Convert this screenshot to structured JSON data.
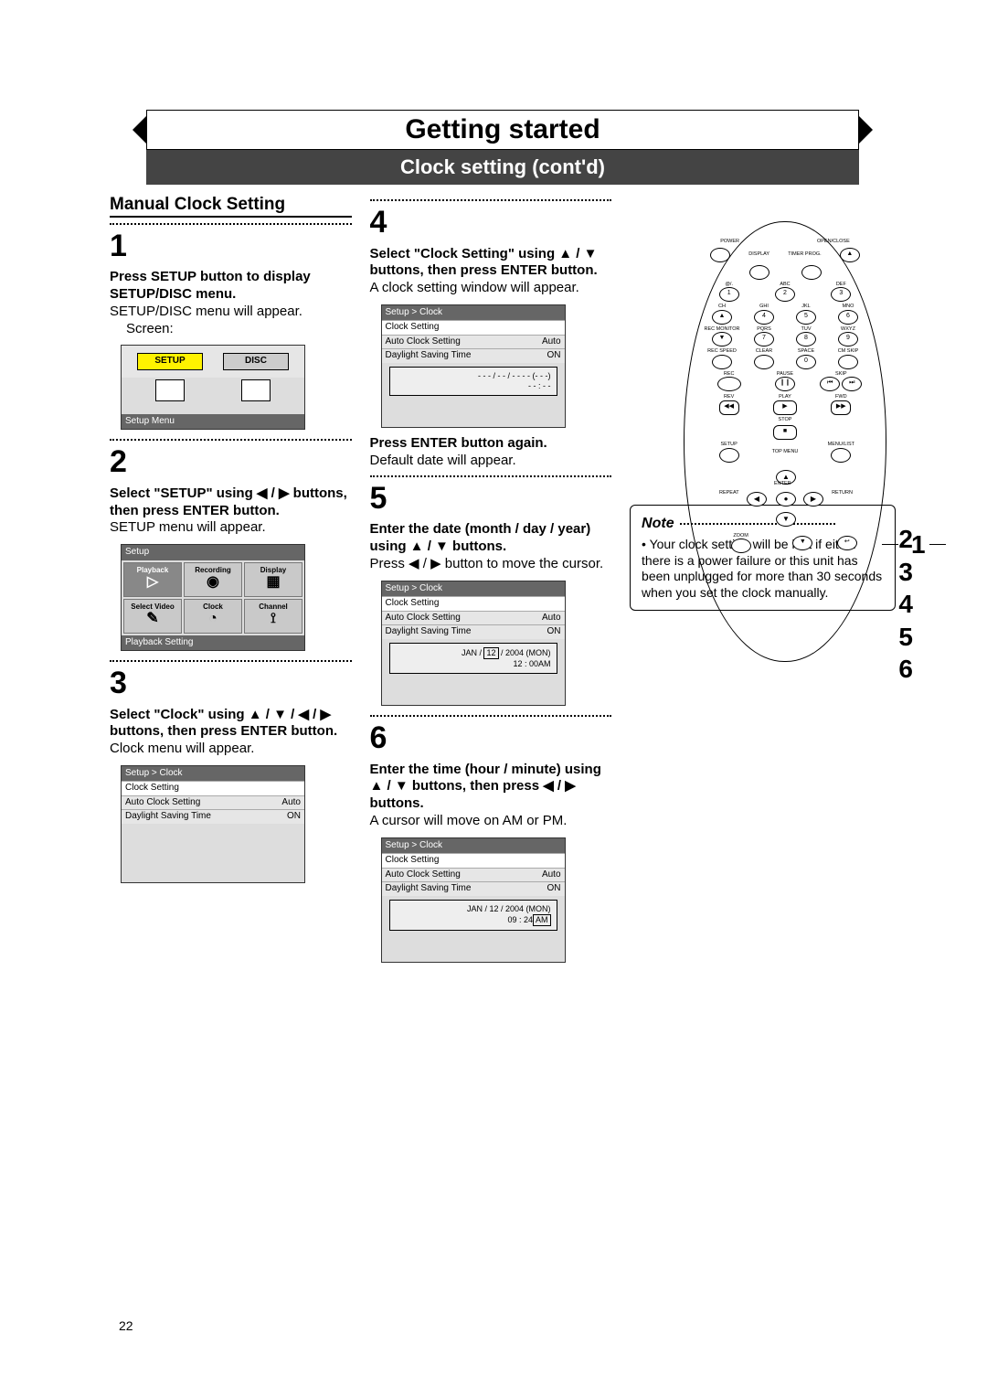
{
  "header": {
    "title": "Getting started",
    "subtitle": "Clock setting (cont'd)"
  },
  "section": {
    "title": "Manual Clock Setting"
  },
  "steps": {
    "s1": {
      "num": "1",
      "bold": "Press SETUP button to display SETUP/DISC menu.",
      "body": "SETUP/DISC menu will appear.",
      "screen_label": "Screen:",
      "tab_setup": "SETUP",
      "tab_disc": "DISC",
      "footer": "Setup Menu"
    },
    "s2": {
      "num": "2",
      "bold": "Select \"SETUP\" using ◀ / ▶ buttons, then press ENTER button.",
      "body": "SETUP menu will appear.",
      "hdr": "Setup",
      "cells": [
        "Playback",
        "Recording",
        "Display",
        "Select Video",
        "Clock",
        "Channel"
      ],
      "footer": "Playback Setting"
    },
    "s3": {
      "num": "3",
      "bold": "Select \"Clock\" using ▲ / ▼ / ◀ / ▶ buttons, then press ENTER button.",
      "body": "Clock menu will appear."
    },
    "s4": {
      "num": "4",
      "bold": "Select \"Clock Setting\" using ▲ / ▼ buttons, then press ENTER button.",
      "body": "A clock setting window will appear.",
      "bold2": "Press ENTER button again.",
      "body2": "Default date will appear."
    },
    "s5": {
      "num": "5",
      "bold": "Enter the date (month / day / year) using ▲ / ▼ buttons.",
      "body": "Press ◀ / ▶ button to move the cursor.",
      "dateline": "JAN / 12 / 2004 (MON)",
      "timeline": "12 : 00AM",
      "hl": "12"
    },
    "s6": {
      "num": "6",
      "bold": "Enter the time (hour / minute) using ▲ / ▼ buttons, then press ◀ / ▶ buttons.",
      "body": "A cursor will move on AM or PM.",
      "dateline": "JAN / 12 / 2004 (MON)",
      "timeline": "09 : 24 AM",
      "hl": "AM"
    }
  },
  "clockscreen": {
    "hdr": "Setup > Clock",
    "rows": [
      {
        "l": "Clock Setting",
        "r": ""
      },
      {
        "l": "Auto Clock Setting",
        "r": "Auto"
      },
      {
        "l": "Daylight Saving Time",
        "r": "ON"
      }
    ],
    "blank_date": "- - - / - - / - - - -  (- - -)",
    "blank_time": "- - : - -"
  },
  "note": {
    "title": "Note",
    "body": "• Your clock setting will be lost if either there is a power failure or this unit has been unplugged for more than 30 seconds when you set the clock manually."
  },
  "remote": {
    "power": "POWER",
    "openclose": "OPEN/CLOSE",
    "display": "DISPLAY",
    "timer": "TIMER PROG.",
    "at": "@/.",
    "abc": "ABC",
    "def": "DEF",
    "ch": "CH",
    "ghi": "GHI",
    "jkl": "JKL",
    "mno": "MNO",
    "rec_mon": "REC MONITOR",
    "pqrs": "PQRS",
    "tuv": "TUV",
    "wxyz": "WXYZ",
    "recspd": "REC SPEED",
    "clear": "CLEAR",
    "space": "SPACE",
    "cmskip": "CM SKIP",
    "rec": "REC",
    "pause": "PAUSE",
    "skip": "SKIP",
    "play": "PLAY",
    "rev": "REV",
    "fwd": "FWD",
    "stop": "STOP",
    "setup": "SETUP",
    "topmenu": "TOP MENU",
    "menulist": "MENU/LIST",
    "repeat": "REPEAT",
    "enter": "ENTER",
    "return": "RETURN",
    "zoom": "ZOOM"
  },
  "callouts": {
    "left": "1",
    "right": [
      "2",
      "3",
      "4",
      "5",
      "6"
    ]
  },
  "page_num": "22"
}
